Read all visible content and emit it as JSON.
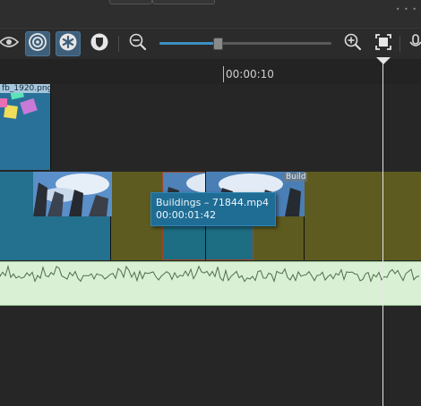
{
  "toolbar": {
    "icons": [
      "eye-icon",
      "target-icon",
      "asterisk-icon",
      "shield-icon",
      "zoom-out-icon",
      "zoom-in-icon",
      "fit-screen-icon",
      "audio-icon"
    ],
    "active_buttons": [
      "target-icon",
      "asterisk-icon"
    ],
    "zoom_level": 0.34
  },
  "ruler": {
    "time_label": "00:00:10"
  },
  "tracks": {
    "image_clip": {
      "label": "fb_1920.png"
    },
    "video_clips": [
      {
        "label": ""
      },
      {
        "label": ""
      },
      {
        "label": "Bu"
      },
      {
        "label": "Build"
      }
    ],
    "colors": {
      "video_track_bg": "#5e5b20",
      "clip_blue": "#24708f",
      "audio_bg": "#d9f0d5",
      "accent": "#3d8fc2"
    }
  },
  "tooltip": {
    "title": "Buildings – 71844.mp4",
    "duration": "00:00:01:42"
  }
}
